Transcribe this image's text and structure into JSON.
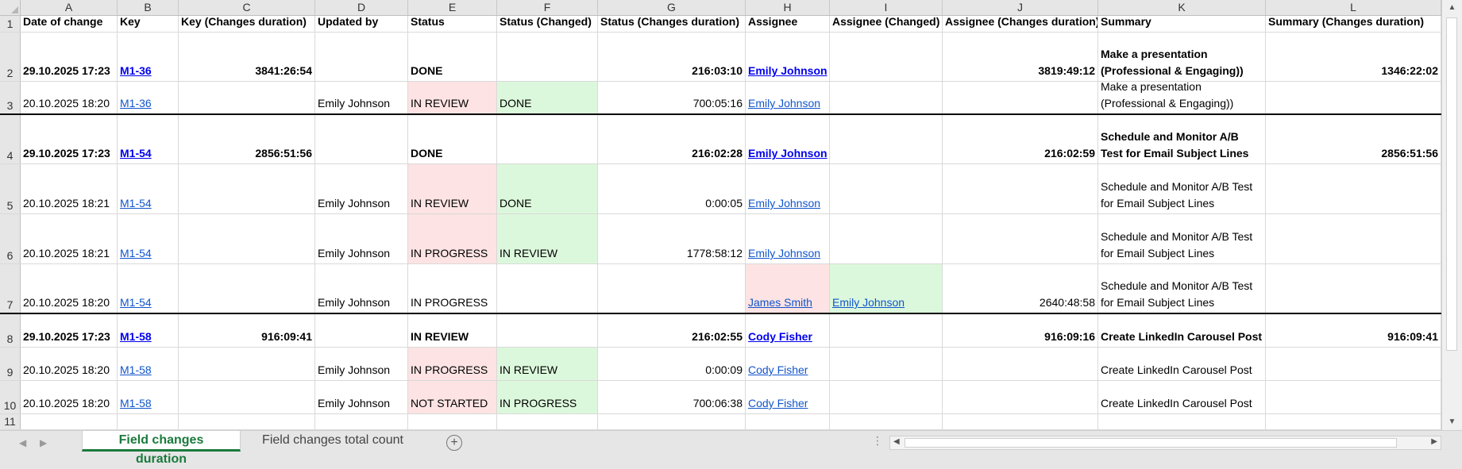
{
  "columns": [
    "A",
    "B",
    "C",
    "D",
    "E",
    "F",
    "G",
    "H",
    "I",
    "J",
    "K",
    "L"
  ],
  "row_numbers": [
    "1",
    "2",
    "3",
    "4",
    "5",
    "6",
    "7",
    "8",
    "9",
    "10",
    "11"
  ],
  "rows": [
    {
      "bold": true,
      "header": true,
      "cells": [
        "Date of change",
        "Key",
        "Key (Changes duration)",
        "Updated by",
        "Status",
        "Status (Changed)",
        "Status (Changes duration)",
        "Assignee",
        "Assignee (Changed)",
        "Assignee (Changes duration)",
        "Summary",
        "Summary (Changes duration)"
      ]
    },
    {
      "bold": true,
      "cells": [
        "29.10.2025 17:23",
        "M1-36",
        "3841:26:54",
        "",
        "DONE",
        "",
        "216:03:10",
        "Emily Johnson",
        "",
        "3819:49:12",
        [
          "Make a presentation",
          "(Professional & Engaging))"
        ],
        "1346:22:02"
      ]
    },
    {
      "bold": false,
      "cells": [
        "20.10.2025 18:20",
        "M1-36",
        "",
        "Emily Johnson",
        "IN REVIEW",
        "DONE",
        "700:05:16",
        "Emily Johnson",
        "",
        "",
        [
          "Make a presentation",
          "(Professional & Engaging))"
        ],
        ""
      ]
    },
    {
      "bold": true,
      "cells": [
        "29.10.2025 17:23",
        "M1-54",
        "2856:51:56",
        "",
        "DONE",
        "",
        "216:02:28",
        "Emily Johnson",
        "",
        "216:02:59",
        [
          "Schedule and Monitor A/B",
          "Test for Email Subject Lines"
        ],
        "2856:51:56"
      ]
    },
    {
      "bold": false,
      "cells": [
        "20.10.2025 18:21",
        "M1-54",
        "",
        "Emily Johnson",
        "IN REVIEW",
        "DONE",
        "0:00:05",
        "Emily Johnson",
        "",
        "",
        [
          "Schedule and Monitor A/B Test",
          "for Email Subject Lines"
        ],
        ""
      ]
    },
    {
      "bold": false,
      "cells": [
        "20.10.2025 18:21",
        "M1-54",
        "",
        "Emily Johnson",
        "IN PROGRESS",
        "IN REVIEW",
        "1778:58:12",
        "Emily Johnson",
        "",
        "",
        [
          "Schedule and Monitor A/B Test",
          "for Email Subject Lines"
        ],
        ""
      ]
    },
    {
      "bold": false,
      "cells": [
        "20.10.2025 18:20",
        "M1-54",
        "",
        "Emily Johnson",
        "IN PROGRESS",
        "",
        "",
        "James Smith",
        "Emily Johnson",
        "2640:48:58",
        [
          "Schedule and Monitor A/B Test",
          "for Email Subject Lines"
        ],
        ""
      ]
    },
    {
      "bold": true,
      "cells": [
        "29.10.2025 17:23",
        "M1-58",
        "916:09:41",
        "",
        "IN REVIEW",
        "",
        "216:02:55",
        "Cody Fisher",
        "",
        "916:09:16",
        "Create LinkedIn Carousel Post",
        "916:09:41"
      ]
    },
    {
      "bold": false,
      "cells": [
        "20.10.2025 18:20",
        "M1-58",
        "",
        "Emily Johnson",
        "IN PROGRESS",
        "IN REVIEW",
        "0:00:09",
        "Cody Fisher",
        "",
        "",
        "Create LinkedIn Carousel Post",
        ""
      ]
    },
    {
      "bold": false,
      "cells": [
        "20.10.2025 18:20",
        "M1-58",
        "",
        "Emily Johnson",
        "NOT STARTED",
        "IN PROGRESS",
        "700:06:38",
        "Cody Fisher",
        "",
        "",
        "Create LinkedIn Carousel Post",
        ""
      ]
    },
    {
      "bold": false,
      "cells": [
        "",
        "",
        "",
        "",
        "",
        "",
        "",
        "",
        "",
        "",
        "",
        ""
      ]
    }
  ],
  "highlight_colors": {
    "changed_from": "#fde3e3",
    "changed_to": "#dcf8dc"
  },
  "tabs": {
    "active": "Field changes duration",
    "inactive": "Field changes total count"
  },
  "icons": {
    "add_sheet": "plus-circle-icon",
    "nav_prev": "chevron-left-icon",
    "nav_next": "chevron-right-icon",
    "more": "ellipsis-icon"
  }
}
